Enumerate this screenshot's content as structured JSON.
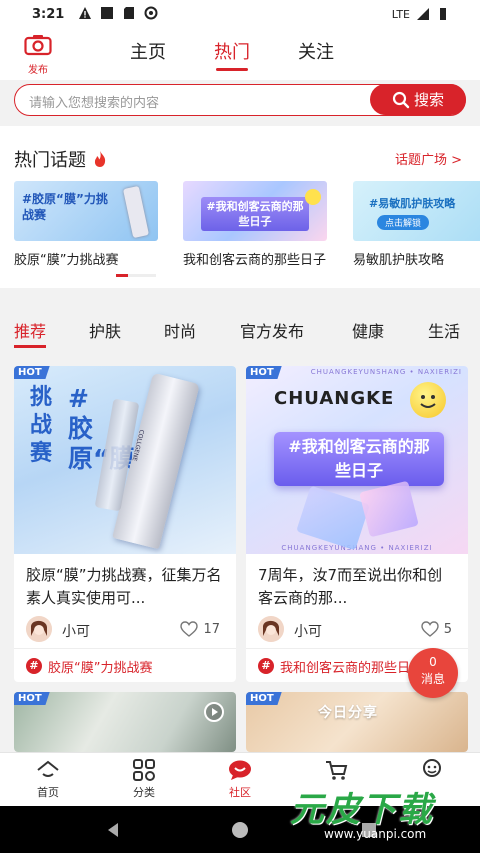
{
  "status_bar": {
    "time": "3:21",
    "network": "LTE"
  },
  "header": {
    "publish_label": "发布",
    "tabs": [
      {
        "label": "主页",
        "active": false
      },
      {
        "label": "热门",
        "active": true
      },
      {
        "label": "关注",
        "active": false
      }
    ]
  },
  "search": {
    "placeholder": "请输入您想搜索的内容",
    "button_label": "搜索"
  },
  "hot_topics": {
    "title": "热门话题",
    "plaza_link": "话题广场 >",
    "cards": [
      {
        "label": "胶原“膜”力挑战赛",
        "image_text": "#胶原“膜”力挑战赛"
      },
      {
        "label": "我和创客云商的那些日子",
        "image_text": "#我和创客云商的那些日子"
      },
      {
        "label": "易敏肌护肤攻略",
        "image_text": "#易敏肌护肤攻略",
        "image_subtext": "点击解锁"
      }
    ]
  },
  "feed": {
    "categories": [
      {
        "label": "推荐",
        "active": true
      },
      {
        "label": "护肤",
        "active": false
      },
      {
        "label": "时尚",
        "active": false
      },
      {
        "label": "官方发布",
        "active": false
      },
      {
        "label": "健康",
        "active": false
      },
      {
        "label": "生活",
        "active": false
      }
    ],
    "posts": [
      {
        "badge": "HOT",
        "description": "胶原“膜”力挑战赛，征集万名素人真实使用可...",
        "user": "小可",
        "likes": "17",
        "topic": "胶原“膜”力挑战赛",
        "image_text": "#胶原“膜”力",
        "image_side_text": "挑战赛",
        "product_brand": "COLLGENE"
      },
      {
        "badge": "HOT",
        "description": "7周年，汝7而至说出你和创客云商的那...",
        "user": "小可",
        "likes": "5",
        "topic": "我和创客云商的那些日子",
        "image_title": "CHUANGKE",
        "image_text": "#我和创客云商的那些日子",
        "image_border_text": "CHUANGKEYUNSHANG • NAXIERIZI"
      },
      {
        "badge": "HOT"
      },
      {
        "badge": "HOT",
        "image_text": "今日分享"
      }
    ]
  },
  "message_bubble": {
    "count": "0",
    "label": "消息"
  },
  "bottom_nav": [
    {
      "label": "首页",
      "icon": "home-icon",
      "active": false
    },
    {
      "label": "分类",
      "icon": "category-icon",
      "active": false
    },
    {
      "label": "社区",
      "icon": "community-icon",
      "active": true
    },
    {
      "label": "",
      "icon": "cart-icon",
      "active": false
    },
    {
      "label": "",
      "icon": "profile-icon",
      "active": false
    }
  ],
  "watermark": {
    "brand": "元皮下载",
    "url": "www.yuanpi.com"
  },
  "colors": {
    "accent": "#d8232a",
    "hot_badge": "#3a73d8",
    "watermark": "#2aa847"
  }
}
